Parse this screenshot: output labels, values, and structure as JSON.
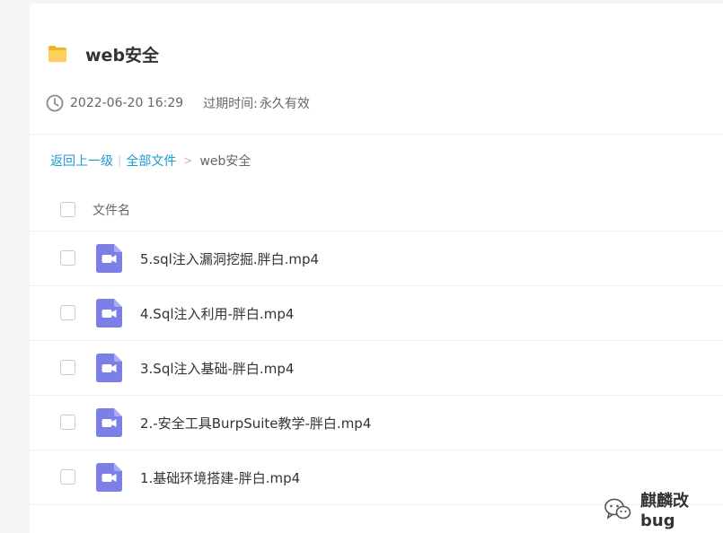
{
  "folder": {
    "title": "web安全",
    "icon": "folder-icon",
    "date": "2022-06-20 16:29",
    "expire_label": "过期时间:",
    "expire_value": "永久有效"
  },
  "breadcrumb": {
    "back": "返回上一级",
    "separator": "|",
    "all_files": "全部文件",
    "arrow": ">",
    "current": "web安全"
  },
  "list": {
    "column_name": "文件名",
    "files": [
      {
        "name": "5.sql注入漏洞挖掘.胖白.mp4",
        "icon": "video-file-icon"
      },
      {
        "name": "4.Sql注入利用-胖白.mp4",
        "icon": "video-file-icon"
      },
      {
        "name": "3.Sql注入基础-胖白.mp4",
        "icon": "video-file-icon"
      },
      {
        "name": "2.-安全工具BurpSuite教学-胖白.mp4",
        "icon": "video-file-icon"
      },
      {
        "name": "1.基础环境搭建-胖白.mp4",
        "icon": "video-file-icon"
      }
    ]
  },
  "watermark": {
    "text": "麒麟改bug",
    "icon": "wechat-icon"
  },
  "colors": {
    "link": "#1b9ad6",
    "video_icon": "#7b7fe6",
    "folder": "#f5c542"
  }
}
